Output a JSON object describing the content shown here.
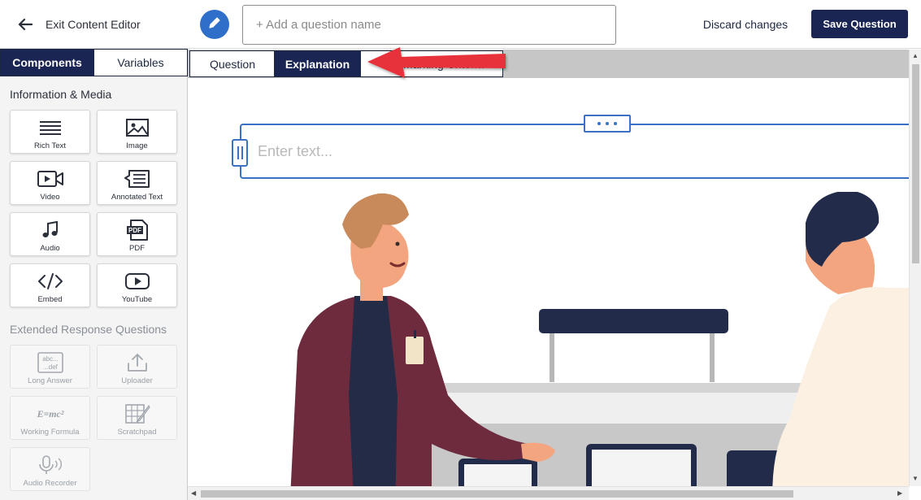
{
  "header": {
    "exit_label": "Exit Content Editor",
    "question_name_placeholder": "+ Add a question name",
    "discard_label": "Discard changes",
    "save_label": "Save Question"
  },
  "sidebar": {
    "tabs": [
      {
        "label": "Components",
        "active": true
      },
      {
        "label": "Variables",
        "active": false
      }
    ],
    "sections": [
      {
        "title": "Information & Media",
        "items": [
          {
            "label": "Rich Text",
            "icon": "rich-text-icon"
          },
          {
            "label": "Image",
            "icon": "image-icon"
          },
          {
            "label": "Video",
            "icon": "video-icon"
          },
          {
            "label": "Annotated Text",
            "icon": "annotated-text-icon"
          },
          {
            "label": "Audio",
            "icon": "music-note-icon"
          },
          {
            "label": "PDF",
            "icon": "pdf-icon"
          },
          {
            "label": "Embed",
            "icon": "code-icon"
          },
          {
            "label": "YouTube",
            "icon": "youtube-icon"
          }
        ]
      },
      {
        "title": "Extended Response Questions",
        "items": [
          {
            "label": "Long Answer",
            "icon": "long-answer-icon",
            "disabled": true
          },
          {
            "label": "Uploader",
            "icon": "upload-icon",
            "disabled": true
          },
          {
            "label": "Working Formula",
            "icon": "formula-icon",
            "disabled": true
          },
          {
            "label": "Scratchpad",
            "icon": "scratchpad-icon",
            "disabled": true
          },
          {
            "label": "Audio Recorder",
            "icon": "microphone-icon",
            "disabled": true
          }
        ]
      }
    ]
  },
  "editor": {
    "tabs": [
      {
        "label": "Question",
        "active": false
      },
      {
        "label": "Explanation",
        "active": true
      },
      {
        "label": "Self-Marking Criteria",
        "active": false
      }
    ],
    "text_placeholder": "Enter text...",
    "long_answer_icon_text": "abc...def",
    "formula_icon_text": "E=mc²",
    "pdf_icon_text": "PDF"
  },
  "colors": {
    "primary_navy": "#1b2553",
    "accent_blue": "#2f6fc9",
    "annotation_red": "#e8313a"
  }
}
